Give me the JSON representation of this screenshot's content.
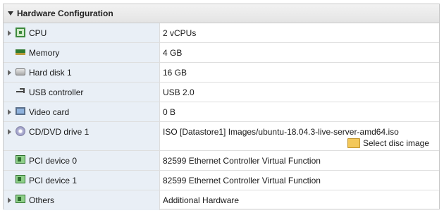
{
  "panel": {
    "title": "Hardware Configuration"
  },
  "rows": [
    {
      "label": "CPU",
      "value": "2 vCPUs",
      "icon": "cpu-icon",
      "expandable": true
    },
    {
      "label": "Memory",
      "value": "4 GB",
      "icon": "memory-icon",
      "expandable": false
    },
    {
      "label": "Hard disk 1",
      "value": "16 GB",
      "icon": "hard-disk-icon",
      "expandable": true
    },
    {
      "label": "USB controller",
      "value": "USB 2.0",
      "icon": "usb-icon",
      "expandable": false
    },
    {
      "label": "Video card",
      "value": "0 B",
      "icon": "video-card-icon",
      "expandable": true
    },
    {
      "label": "CD/DVD drive 1",
      "value": "ISO [Datastore1] Images/ubuntu-18.04.3-live-server-amd64.iso",
      "icon": "cd-dvd-icon",
      "expandable": true,
      "action": "Select disc image"
    },
    {
      "label": "PCI device 0",
      "value": "82599 Ethernet Controller Virtual Function",
      "icon": "pci-device-icon",
      "expandable": false
    },
    {
      "label": "PCI device 1",
      "value": "82599 Ethernet Controller Virtual Function",
      "icon": "pci-device-icon",
      "expandable": false
    },
    {
      "label": "Others",
      "value": "Additional Hardware",
      "icon": "pci-device-icon",
      "expandable": true
    }
  ]
}
